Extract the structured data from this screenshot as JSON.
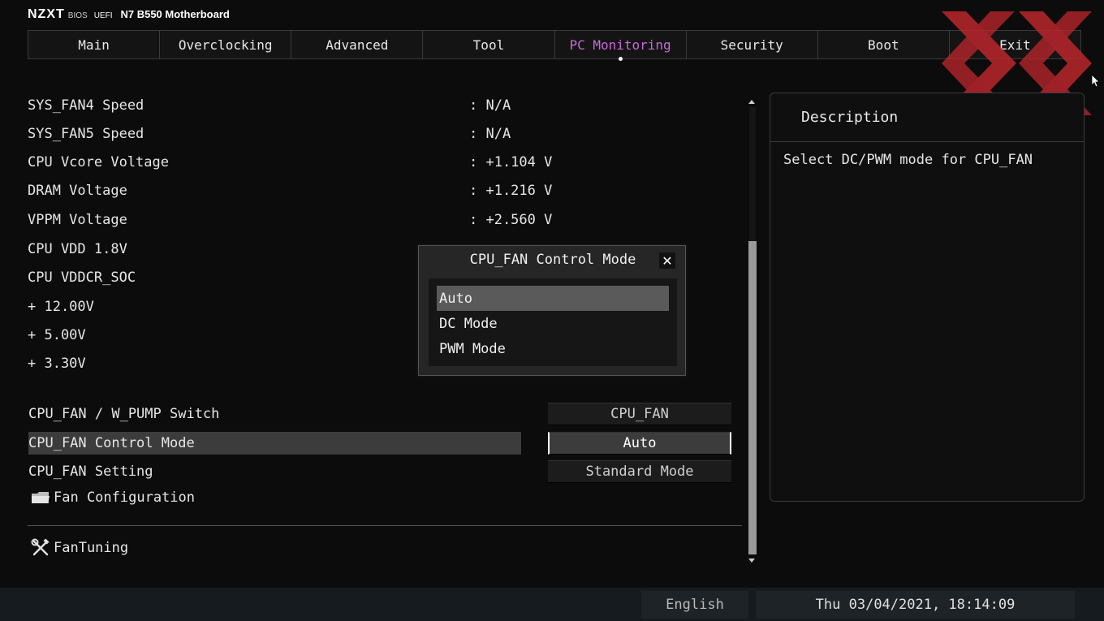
{
  "brand": {
    "logo": "NZXT",
    "bios": "BIOS",
    "uefi": "UEFI",
    "board": "N7 B550 Motherboard"
  },
  "tabs": [
    {
      "label": "Main"
    },
    {
      "label": "Overclocking"
    },
    {
      "label": "Advanced"
    },
    {
      "label": "Tool"
    },
    {
      "label": "PC Monitoring",
      "active": true
    },
    {
      "label": "Security"
    },
    {
      "label": "Boot"
    },
    {
      "label": "Exit"
    }
  ],
  "monitor": [
    {
      "label": "SYS_FAN4 Speed",
      "value": ": N/A"
    },
    {
      "label": "SYS_FAN5 Speed",
      "value": ": N/A"
    },
    {
      "label": "CPU Vcore Voltage",
      "value": ": +1.104 V"
    },
    {
      "label": "DRAM Voltage",
      "value": ": +1.216 V"
    },
    {
      "label": "VPPM Voltage",
      "value": ": +2.560 V"
    },
    {
      "label": "CPU VDD 1.8V",
      "value": ""
    },
    {
      "label": "CPU VDDCR_SOC",
      "value": ""
    },
    {
      "label": "+ 12.00V",
      "value": ""
    },
    {
      "label": "+ 5.00V",
      "value": ""
    },
    {
      "label": "+ 3.30V",
      "value": ""
    }
  ],
  "options": [
    {
      "label": "CPU_FAN / W_PUMP Switch",
      "value": "CPU_FAN"
    },
    {
      "label": "CPU_FAN Control Mode",
      "value": "Auto"
    },
    {
      "label": "CPU_FAN Setting",
      "value": "Standard Mode"
    }
  ],
  "submenus": {
    "fan_configuration": "Fan Configuration",
    "fan_tuning": "FanTuning"
  },
  "description": {
    "title": "Description",
    "text": "Select DC/PWM mode for CPU_FAN"
  },
  "modal": {
    "title": "CPU_FAN Control Mode",
    "close": "✕",
    "options": [
      "Auto",
      "DC Mode",
      "PWM Mode"
    ],
    "selected_index": 0
  },
  "status": {
    "language": "English",
    "datetime": "Thu 03/04/2021, 18:14:09"
  },
  "colors": {
    "active_tab": "#c86ad6",
    "watermark": "#c0272d"
  },
  "icons": [
    "folder-icon",
    "tools-icon",
    "close-icon",
    "mouse-cursor-icon"
  ]
}
